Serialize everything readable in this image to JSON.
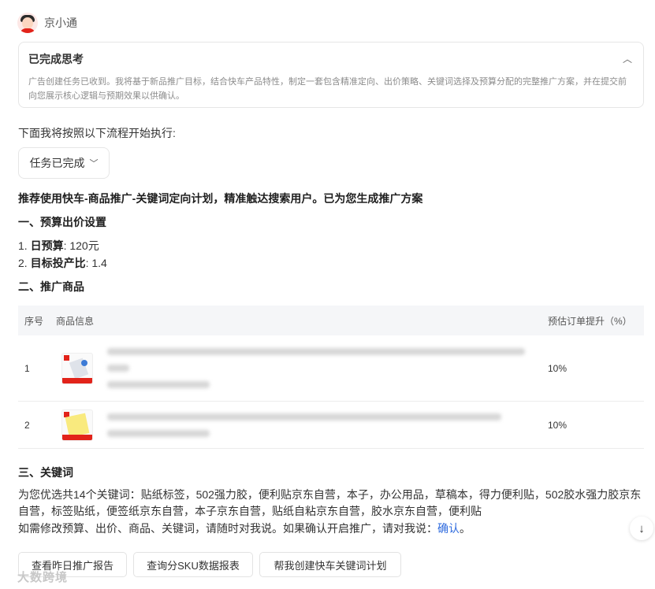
{
  "header": {
    "bot_name": "京小通"
  },
  "thinking": {
    "title": "已完成思考",
    "text": "广告创建任务已收到。我将基于新品推广目标，结合快车产品特性，制定一套包含精准定向、出价策略、关键词选择及预算分配的完整推广方案，并在提交前向您展示核心逻辑与预期效果以供确认。"
  },
  "flow_intro": "下面我将按照以下流程开始执行:",
  "task_status": "任务已完成",
  "recommendation": "推荐使用快车-商品推广-关键词定向计划，精准触达搜索用户。已为您生成推广方案",
  "budget_section": {
    "title": "一、预算出价设置",
    "items": [
      {
        "num": "1.",
        "label": "日预算",
        "value": ": 120元"
      },
      {
        "num": "2.",
        "label": "目标投产比",
        "value": ": 1.4"
      }
    ]
  },
  "products_section": {
    "title": "二、推广商品",
    "columns": {
      "index": "序号",
      "info": "商品信息",
      "prediction": "预估订单提升（%）"
    },
    "rows": [
      {
        "index": "1",
        "prediction": "10%"
      },
      {
        "index": "2",
        "prediction": "10%"
      }
    ]
  },
  "keywords_section": {
    "title": "三、关键词",
    "summary": "为您优选共14个关键词：贴纸标签，502强力胶，便利贴京东自营，本子，办公用品，草稿本，得力便利贴，502胶水强力胶京东自营，标签贴纸，便签纸京东自营，本子京东自营，贴纸自粘京东自营，胶水京东自营，便利贴",
    "confirm_prefix": "如需修改预算、出价、商品、关键词，请随时对我说。如果确认开启推广，请对我说：",
    "confirm_link": "确认",
    "confirm_suffix": "。"
  },
  "actions": [
    {
      "label": "查看昨日推广报告"
    },
    {
      "label": "查询分SKU数据报表"
    },
    {
      "label": "帮我创建快车关键词计划"
    }
  ],
  "watermark": "大数跨境",
  "colors": {
    "link": "#2f6bde",
    "brand_red": "#e2231a"
  }
}
